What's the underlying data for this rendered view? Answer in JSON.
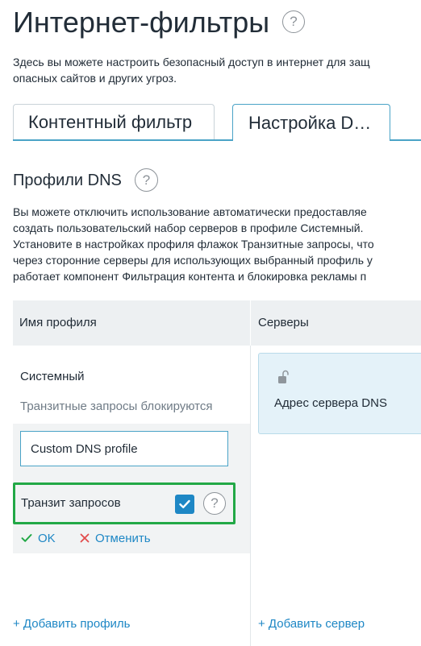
{
  "header": {
    "title": "Интернет-фильтры",
    "intro_lines": [
      "Здесь вы можете настроить безопасный доступ в интернет для защ",
      "опасных сайтов и других угроз."
    ]
  },
  "tabs": [
    {
      "label": "Контентный фильтр",
      "active": false
    },
    {
      "label": "Настройка D…",
      "active": true
    }
  ],
  "section": {
    "title": "Профили DNS",
    "description_lines": [
      "Вы можете отключить использование автоматически предоставляе",
      "создать пользовательский набор серверов в профиле Системный.",
      "Установите в настройках профиля флажок Транзитные запросы, что",
      "через сторонние серверы для использующих выбранный профиль у",
      "работает компонент Фильтрация контента и блокировка рекламы п"
    ]
  },
  "table": {
    "headers": {
      "profile_name": "Имя профиля",
      "servers": "Серверы"
    },
    "profile": {
      "name": "Системный",
      "status": "Транзитные запросы блокируются"
    },
    "edit": {
      "name_value": "Custom DNS profile",
      "transit_label": "Транзит запросов",
      "transit_checked": true,
      "ok_label": "OK",
      "cancel_label": "Отменить"
    },
    "server_card": {
      "label": "Адрес сервера DNS",
      "icon": "unlocked-lock-icon"
    }
  },
  "footer": {
    "add_profile": "+ Добавить профиль",
    "add_server": "+ Добавить сервер"
  },
  "colors": {
    "accent": "#1e87c5",
    "highlight": "#22a846",
    "tab_border": "#4aa3c7",
    "server_card_bg": "#e4f2f9"
  }
}
